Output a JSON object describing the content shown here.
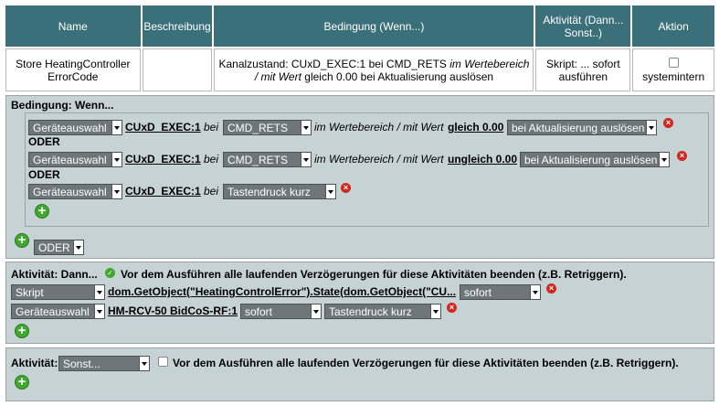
{
  "table": {
    "headers": [
      "Name",
      "Beschreibung",
      "Bedingung (Wenn...)",
      "Aktivität (Dann... Sonst..)",
      "Aktion"
    ],
    "row": {
      "name": "Store HeatingController ErrorCode",
      "description": "",
      "condition_prefix": "Kanalzustand: CUxD_EXEC:1 bei CMD_RETS",
      "condition_italic": "im Wertebereich / mit Wert",
      "condition_suffix": "gleich 0.00 bei Aktualisierung auslösen",
      "activity": "Skript: ... sofort ausführen",
      "action_label": "systemintern"
    }
  },
  "condition": {
    "title": "Bedingung: Wenn...",
    "or_label": "ODER",
    "bei": "bei",
    "range_text": "im Wertebereich / mit Wert",
    "rows": [
      {
        "type_select": "Geräteauswahl",
        "device": "CUxD_EXEC:1",
        "param_select": "CMD_RETS",
        "value": "gleich 0.00",
        "trigger_select": "bei Aktualisierung auslösen"
      },
      {
        "type_select": "Geräteauswahl",
        "device": "CUxD_EXEC:1",
        "param_select": "CMD_RETS",
        "value": "ungleich 0.00",
        "trigger_select": "bei Aktualisierung auslösen"
      },
      {
        "type_select": "Geräteauswahl",
        "device": "CUxD_EXEC:1",
        "param_select": "Tastendruck kurz"
      }
    ],
    "operator_select": "ODER"
  },
  "then": {
    "title": "Aktivität: Dann...",
    "retrigger_text": "Vor dem Ausführen alle laufenden Verzögerungen für diese Aktivitäten beenden (z.B. Retriggern).",
    "retrigger_checked": true,
    "rows": [
      {
        "type_select": "Skript",
        "target": "dom.GetObject(\"HeatingControlError\").State(dom.GetObject(\"CU...",
        "timing_select": "sofort"
      },
      {
        "type_select": "Geräteauswahl",
        "target": "HM-RCV-50 BidCoS-RF:1",
        "timing_select": "sofort",
        "action_select": "Tastendruck kurz"
      }
    ]
  },
  "else": {
    "title": "Aktivität:",
    "mode_select": "Sonst...",
    "retrigger_text": "Vor dem Ausführen alle laufenden Verzögerungen für diese Aktivitäten beenden (z.B. Retriggern).",
    "retrigger_checked": false
  },
  "colors": {
    "header_bg": "#3b6f79",
    "section_bg": "#c7d2d4",
    "add": "#3fa82f",
    "delete": "#d0281e"
  }
}
